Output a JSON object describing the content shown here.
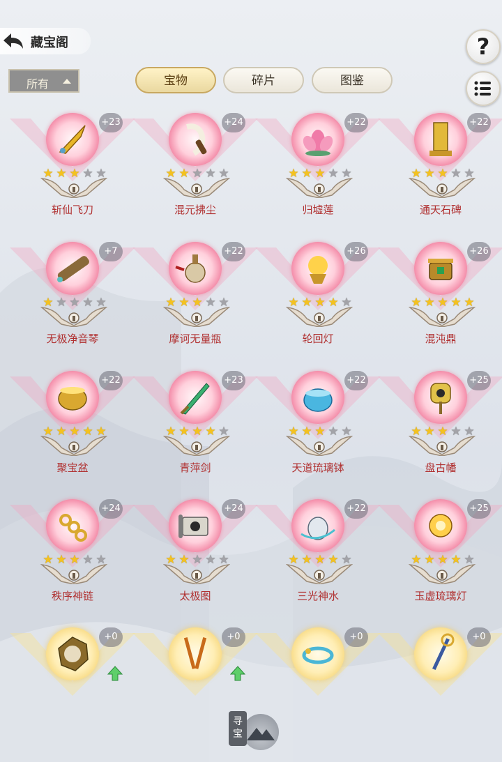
{
  "header": {
    "title": "藏宝阁"
  },
  "filter": {
    "label": "所有"
  },
  "tabs": [
    {
      "label": "宝物",
      "active": true
    },
    {
      "label": "碎片",
      "active": false
    },
    {
      "label": "图鉴",
      "active": false
    }
  ],
  "colors": {
    "orb_pink": "#f48fab",
    "orb_gold": "#f6d67a",
    "star_on": "#f4c21f",
    "star_off": "#a3a3a8",
    "name_red": "#b03030"
  },
  "items": [
    {
      "name": "斩仙飞刀",
      "level": "+23",
      "stars": 3,
      "icon": "flying-dagger-icon"
    },
    {
      "name": "混元拂尘",
      "level": "+24",
      "stars": 2,
      "icon": "whisk-icon"
    },
    {
      "name": "归墟莲",
      "level": "+22",
      "stars": 3,
      "icon": "lotus-icon"
    },
    {
      "name": "通天石碑",
      "level": "+22",
      "stars": 3,
      "icon": "stone-tablet-icon"
    },
    {
      "name": "无极净音琴",
      "level": "+7",
      "stars": 1,
      "icon": "zither-icon"
    },
    {
      "name": "摩诃无量瓶",
      "level": "+22",
      "stars": 3,
      "icon": "vase-icon"
    },
    {
      "name": "轮回灯",
      "level": "+26",
      "stars": 4,
      "icon": "lamp-icon"
    },
    {
      "name": "混沌鼎",
      "level": "+26",
      "stars": 5,
      "icon": "cauldron-icon"
    },
    {
      "name": "聚宝盆",
      "level": "+22",
      "stars": 5,
      "icon": "treasure-bowl-icon"
    },
    {
      "name": "青萍剑",
      "level": "+23",
      "stars": 4,
      "icon": "sword-icon"
    },
    {
      "name": "天道琉璃钵",
      "level": "+22",
      "stars": 3,
      "icon": "glass-bowl-icon"
    },
    {
      "name": "盘古幡",
      "level": "+25",
      "stars": 3,
      "icon": "banner-icon"
    },
    {
      "name": "秩序神链",
      "level": "+24",
      "stars": 3,
      "icon": "chain-icon"
    },
    {
      "name": "太极图",
      "level": "+24",
      "stars": 2,
      "icon": "scroll-icon"
    },
    {
      "name": "三光神水",
      "level": "+22",
      "stars": 4,
      "icon": "holy-water-icon"
    },
    {
      "name": "玉虚琉璃灯",
      "level": "+25",
      "stars": 4,
      "icon": "jade-lamp-icon"
    },
    {
      "name": "",
      "level": "+0",
      "stars": 0,
      "icon": "mirror-icon",
      "upgrade": true
    },
    {
      "name": "",
      "level": "+0",
      "stars": 0,
      "icon": "twin-swords-icon",
      "upgrade": true
    },
    {
      "name": "",
      "level": "+0",
      "stars": 0,
      "icon": "bracelet-icon",
      "upgrade": false
    },
    {
      "name": "",
      "level": "+0",
      "stars": 0,
      "icon": "staff-icon",
      "upgrade": false
    }
  ],
  "bottom_button": {
    "label_line1": "寻",
    "label_line2": "宝"
  }
}
